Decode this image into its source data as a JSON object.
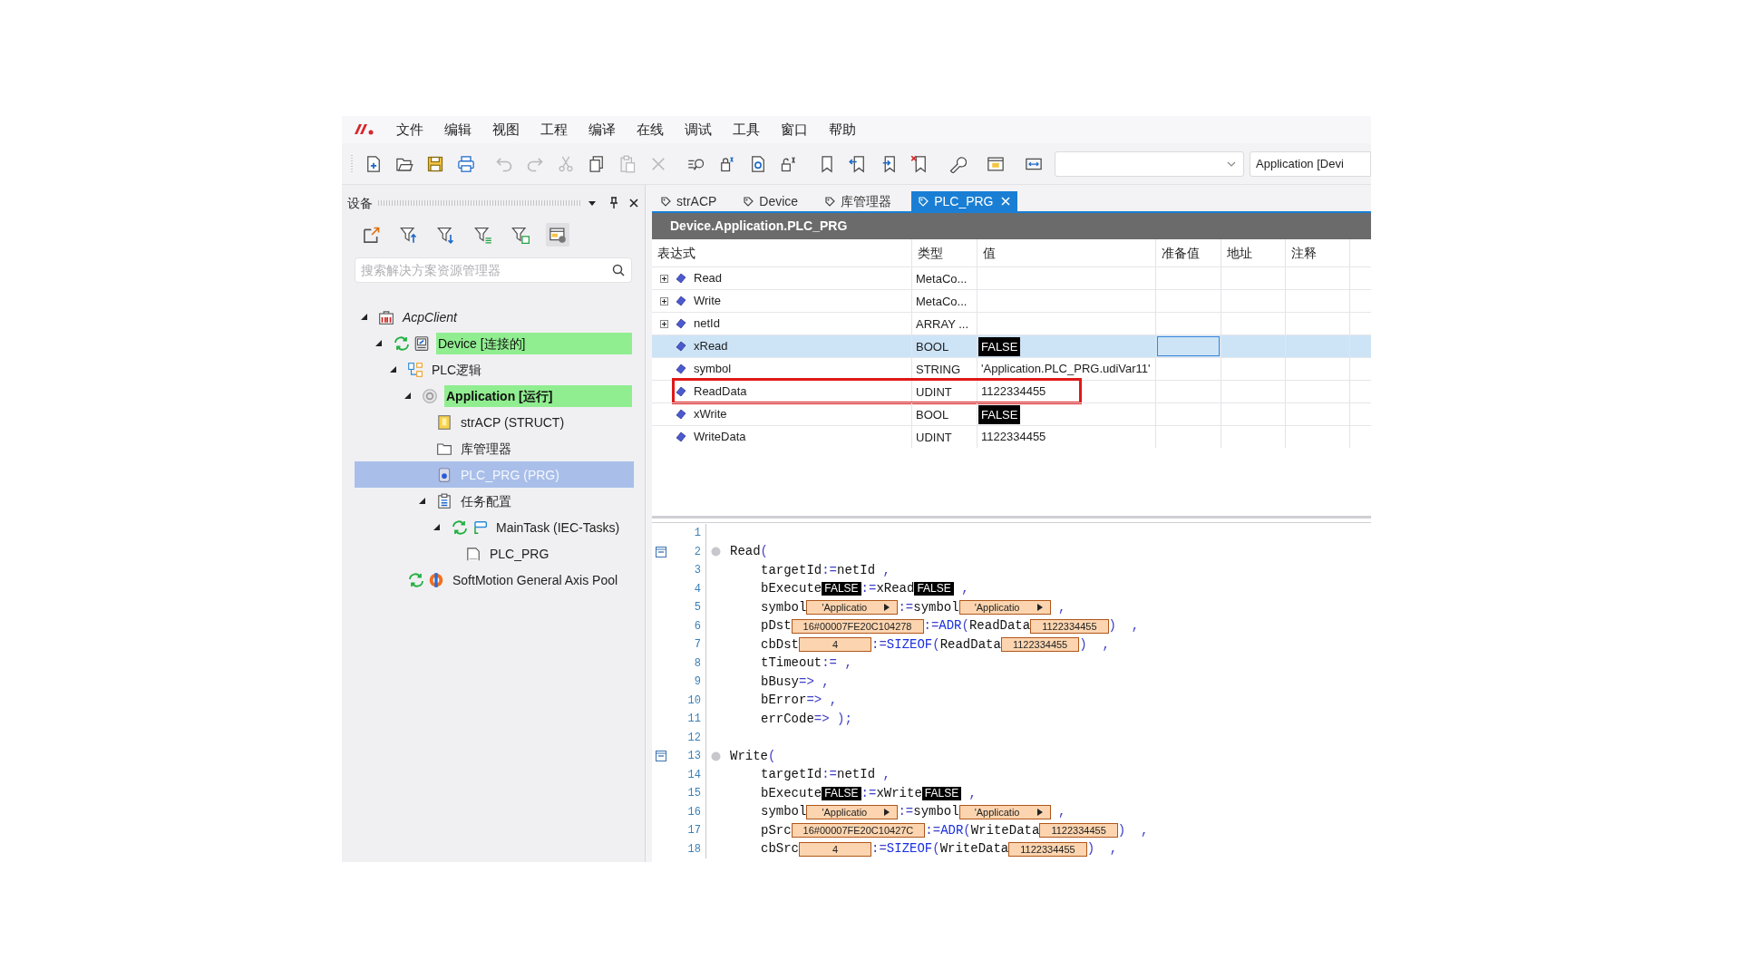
{
  "menu": [
    "文件",
    "编辑",
    "视图",
    "工程",
    "编译",
    "在线",
    "调试",
    "工具",
    "窗口",
    "帮助"
  ],
  "toolbar": {
    "application_field": "Application [Devi"
  },
  "device_panel": {
    "title": "设备",
    "search": {
      "placeholder": "搜索解决方案资源管理器"
    },
    "tree": [
      {
        "label": "AcpClient",
        "kind": "project",
        "expanded": true,
        "synced": false,
        "online": false,
        "selected": false,
        "children": [
          {
            "label": "Device [连接的]",
            "kind": "device",
            "expanded": true,
            "synced": true,
            "online": true,
            "selected": false,
            "children": [
              {
                "label": "PLC逻辑",
                "kind": "plc_logic",
                "expanded": true,
                "synced": false,
                "online": false,
                "selected": false,
                "children": [
                  {
                    "label": "Application [运行]",
                    "kind": "application",
                    "expanded": true,
                    "synced": false,
                    "online": true,
                    "selected": false,
                    "children": [
                      {
                        "label": "strACP (STRUCT)",
                        "kind": "dut",
                        "expanded": false,
                        "synced": false,
                        "online": false,
                        "selected": false
                      },
                      {
                        "label": "库管理器",
                        "kind": "library",
                        "expanded": false,
                        "synced": false,
                        "online": false,
                        "selected": false
                      },
                      {
                        "label": "PLC_PRG (PRG)",
                        "kind": "pou",
                        "expanded": false,
                        "synced": false,
                        "online": false,
                        "selected": true
                      },
                      {
                        "label": "任务配置",
                        "kind": "task_config",
                        "expanded": true,
                        "synced": false,
                        "online": false,
                        "selected": false,
                        "children": [
                          {
                            "label": "MainTask (IEC-Tasks)",
                            "kind": "task",
                            "expanded": true,
                            "synced": true,
                            "online": false,
                            "selected": false,
                            "children": [
                              {
                                "label": "PLC_PRG",
                                "kind": "task_call",
                                "expanded": false,
                                "synced": false,
                                "online": false,
                                "selected": false
                              }
                            ]
                          }
                        ]
                      }
                    ]
                  }
                ]
              },
              {
                "label": "SoftMotion General Axis Pool",
                "kind": "axis_pool",
                "expanded": false,
                "synced": true,
                "online": false,
                "selected": false
              }
            ]
          }
        ]
      }
    ]
  },
  "editor": {
    "tabs": [
      {
        "label": "strACP",
        "selected": false
      },
      {
        "label": "Device",
        "selected": false
      },
      {
        "label": "库管理器",
        "selected": false
      },
      {
        "label": "PLC_PRG",
        "selected": true
      }
    ],
    "title": "Device.Application.PLC_PRG",
    "watch": {
      "columns": [
        "表达式",
        "类型",
        "值",
        "准备值",
        "地址",
        "注释"
      ],
      "rows": [
        {
          "name": "Read",
          "type": "MetaCo...",
          "kind": "struct",
          "selected": false,
          "highlighted": false
        },
        {
          "name": "Write",
          "type": "MetaCo...",
          "kind": "struct",
          "selected": false,
          "highlighted": false
        },
        {
          "name": "netId",
          "type": "ARRAY ...",
          "kind": "struct",
          "selected": false,
          "highlighted": false
        },
        {
          "name": "xRead",
          "type": "BOOL",
          "value": "FALSE",
          "kind": "bool",
          "selected": true,
          "highlighted": false
        },
        {
          "name": "symbol",
          "type": "STRING",
          "value": "'Application.PLC_PRG.udiVar11'",
          "kind": "plain",
          "selected": false,
          "highlighted": false
        },
        {
          "name": "ReadData",
          "type": "UDINT",
          "value": "1122334455",
          "kind": "plain",
          "selected": false,
          "highlighted": true
        },
        {
          "name": "xWrite",
          "type": "BOOL",
          "value": "FALSE",
          "kind": "bool",
          "selected": false,
          "highlighted": false
        },
        {
          "name": "WriteData",
          "type": "UDINT",
          "value": "1122334455",
          "kind": "plain",
          "selected": false,
          "highlighted": false
        }
      ]
    },
    "code": [
      {
        "number": "1",
        "fold": false,
        "marker": false
      },
      {
        "number": "2",
        "fold": true,
        "marker": true,
        "segments": [
          {
            "kind": "id",
            "text": "Read"
          },
          {
            "kind": "op",
            "text": "("
          }
        ],
        "children": [
          {
            "number": "3",
            "fold": false,
            "marker": false,
            "segments": [
              {
                "kind": "id",
                "text": "targetId"
              },
              {
                "kind": "op",
                "text": ":="
              },
              {
                "kind": "id",
                "text": "netId"
              },
              {
                "kind": "op",
                "text": " ,"
              }
            ]
          },
          {
            "number": "4",
            "fold": false,
            "marker": false,
            "segments": [
              {
                "kind": "id",
                "text": "bExecute"
              },
              {
                "kind": "bool",
                "text": "FALSE"
              },
              {
                "kind": "op",
                "text": ":="
              },
              {
                "kind": "id",
                "text": "xRead"
              },
              {
                "kind": "bool",
                "text": "FALSE"
              },
              {
                "kind": "op",
                "text": " ,"
              }
            ]
          },
          {
            "number": "5",
            "fold": false,
            "marker": false,
            "segments": [
              {
                "kind": "id",
                "text": "symbol"
              },
              {
                "kind": "monitor_string",
                "text": "'Applicatio"
              },
              {
                "kind": "op",
                "text": ":="
              },
              {
                "kind": "id",
                "text": "symbol"
              },
              {
                "kind": "monitor_string",
                "text": "'Applicatio"
              },
              {
                "kind": "op",
                "text": " ,"
              }
            ]
          },
          {
            "number": "6",
            "fold": false,
            "marker": false,
            "segments": [
              {
                "kind": "id",
                "text": "pDst"
              },
              {
                "kind": "monitor",
                "text": "16#00007FE20C104278"
              },
              {
                "kind": "op",
                "text": ":="
              },
              {
                "kind": "fn",
                "text": "ADR"
              },
              {
                "kind": "op",
                "text": "("
              },
              {
                "kind": "id",
                "text": "ReadData"
              },
              {
                "kind": "monitor",
                "text": "1122334455"
              },
              {
                "kind": "op",
                "text": ")  ,"
              }
            ]
          },
          {
            "number": "7",
            "fold": false,
            "marker": false,
            "segments": [
              {
                "kind": "id",
                "text": "cbDst"
              },
              {
                "kind": "monitor",
                "text": "4"
              },
              {
                "kind": "op",
                "text": ":="
              },
              {
                "kind": "fn",
                "text": "SIZEOF"
              },
              {
                "kind": "op",
                "text": "("
              },
              {
                "kind": "id",
                "text": "ReadData"
              },
              {
                "kind": "monitor",
                "text": "1122334455"
              },
              {
                "kind": "op",
                "text": ")  ,"
              }
            ]
          },
          {
            "number": "8",
            "fold": false,
            "marker": false,
            "segments": [
              {
                "kind": "id",
                "text": "tTimeout"
              },
              {
                "kind": "op",
                "text": ":= ,"
              }
            ]
          },
          {
            "number": "9",
            "fold": false,
            "marker": false,
            "segments": [
              {
                "kind": "id",
                "text": "bBusy"
              },
              {
                "kind": "op",
                "text": "=> ,"
              }
            ]
          },
          {
            "number": "10",
            "fold": false,
            "marker": false,
            "segments": [
              {
                "kind": "id",
                "text": "bError"
              },
              {
                "kind": "op",
                "text": "=> ,"
              }
            ]
          },
          {
            "number": "11",
            "fold": false,
            "marker": false,
            "segments": [
              {
                "kind": "id",
                "text": "errCode"
              },
              {
                "kind": "op",
                "text": "=> );"
              }
            ]
          }
        ]
      },
      {
        "number": "12",
        "fold": false,
        "marker": false
      },
      {
        "number": "13",
        "fold": true,
        "marker": true,
        "segments": [
          {
            "kind": "id",
            "text": "Write"
          },
          {
            "kind": "op",
            "text": "("
          }
        ],
        "children": [
          {
            "number": "14",
            "fold": false,
            "marker": false,
            "segments": [
              {
                "kind": "id",
                "text": "targetId"
              },
              {
                "kind": "op",
                "text": ":="
              },
              {
                "kind": "id",
                "text": "netId"
              },
              {
                "kind": "op",
                "text": " ,"
              }
            ]
          },
          {
            "number": "15",
            "fold": false,
            "marker": false,
            "segments": [
              {
                "kind": "id",
                "text": "bExecute"
              },
              {
                "kind": "bool",
                "text": "FALSE"
              },
              {
                "kind": "op",
                "text": ":="
              },
              {
                "kind": "id",
                "text": "xWrite"
              },
              {
                "kind": "bool",
                "text": "FALSE"
              },
              {
                "kind": "op",
                "text": " ,"
              }
            ]
          },
          {
            "number": "16",
            "fold": false,
            "marker": false,
            "segments": [
              {
                "kind": "id",
                "text": "symbol"
              },
              {
                "kind": "monitor_string",
                "text": "'Applicatio"
              },
              {
                "kind": "op",
                "text": ":="
              },
              {
                "kind": "id",
                "text": "symbol"
              },
              {
                "kind": "monitor_string",
                "text": "'Applicatio"
              },
              {
                "kind": "op",
                "text": " ,"
              }
            ]
          },
          {
            "number": "17",
            "fold": false,
            "marker": false,
            "segments": [
              {
                "kind": "id",
                "text": "pSrc"
              },
              {
                "kind": "monitor",
                "text": "16#00007FE20C10427C"
              },
              {
                "kind": "op",
                "text": ":="
              },
              {
                "kind": "fn",
                "text": "ADR"
              },
              {
                "kind": "op",
                "text": "("
              },
              {
                "kind": "id",
                "text": "WriteData"
              },
              {
                "kind": "monitor",
                "text": "1122334455"
              },
              {
                "kind": "op",
                "text": ")  ,"
              }
            ]
          },
          {
            "number": "18",
            "fold": false,
            "marker": false,
            "segments": [
              {
                "kind": "id",
                "text": "cbSrc"
              },
              {
                "kind": "monitor",
                "text": "4"
              },
              {
                "kind": "op",
                "text": ":="
              },
              {
                "kind": "fn",
                "text": "SIZEOF"
              },
              {
                "kind": "op",
                "text": "("
              },
              {
                "kind": "id",
                "text": "WriteData"
              },
              {
                "kind": "monitor",
                "text": "1122334455"
              },
              {
                "kind": "op",
                "text": ")  ,"
              }
            ]
          }
        ]
      }
    ]
  }
}
